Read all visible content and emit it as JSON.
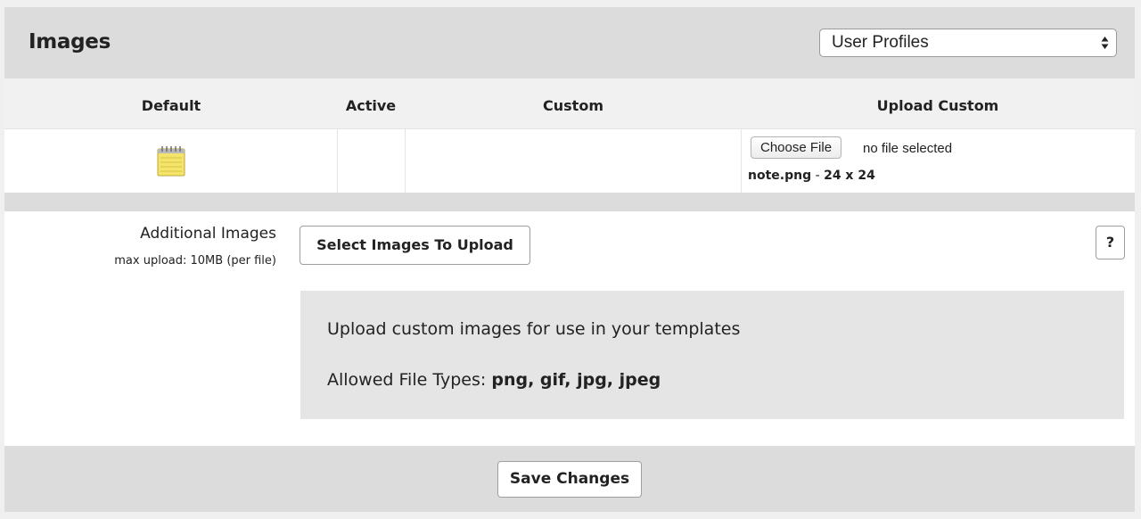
{
  "header": {
    "title": "Images",
    "category_select": {
      "selected": "User Profiles"
    }
  },
  "table": {
    "columns": [
      "Default",
      "Active",
      "Custom",
      "Upload Custom"
    ],
    "row": {
      "default_icon": "note-icon",
      "upload": {
        "choose_file_label": "Choose File",
        "no_file_text": "no file selected",
        "file_name": "note.png",
        "dash": "-",
        "file_size": "24 x 24"
      }
    }
  },
  "additional": {
    "label": "Additional Images",
    "max_upload": "max upload: 10MB (per file)",
    "select_button": "Select Images To Upload",
    "help_button": "?"
  },
  "info": {
    "line1": "Upload custom images for use in your templates",
    "allowed_label": "Allowed File Types:",
    "allowed_types": "png, gif, jpg, jpeg"
  },
  "footer": {
    "save_button": "Save Changes"
  },
  "colors": {
    "band": "#dcdcdc",
    "note_yellow": "#f4e46a"
  }
}
